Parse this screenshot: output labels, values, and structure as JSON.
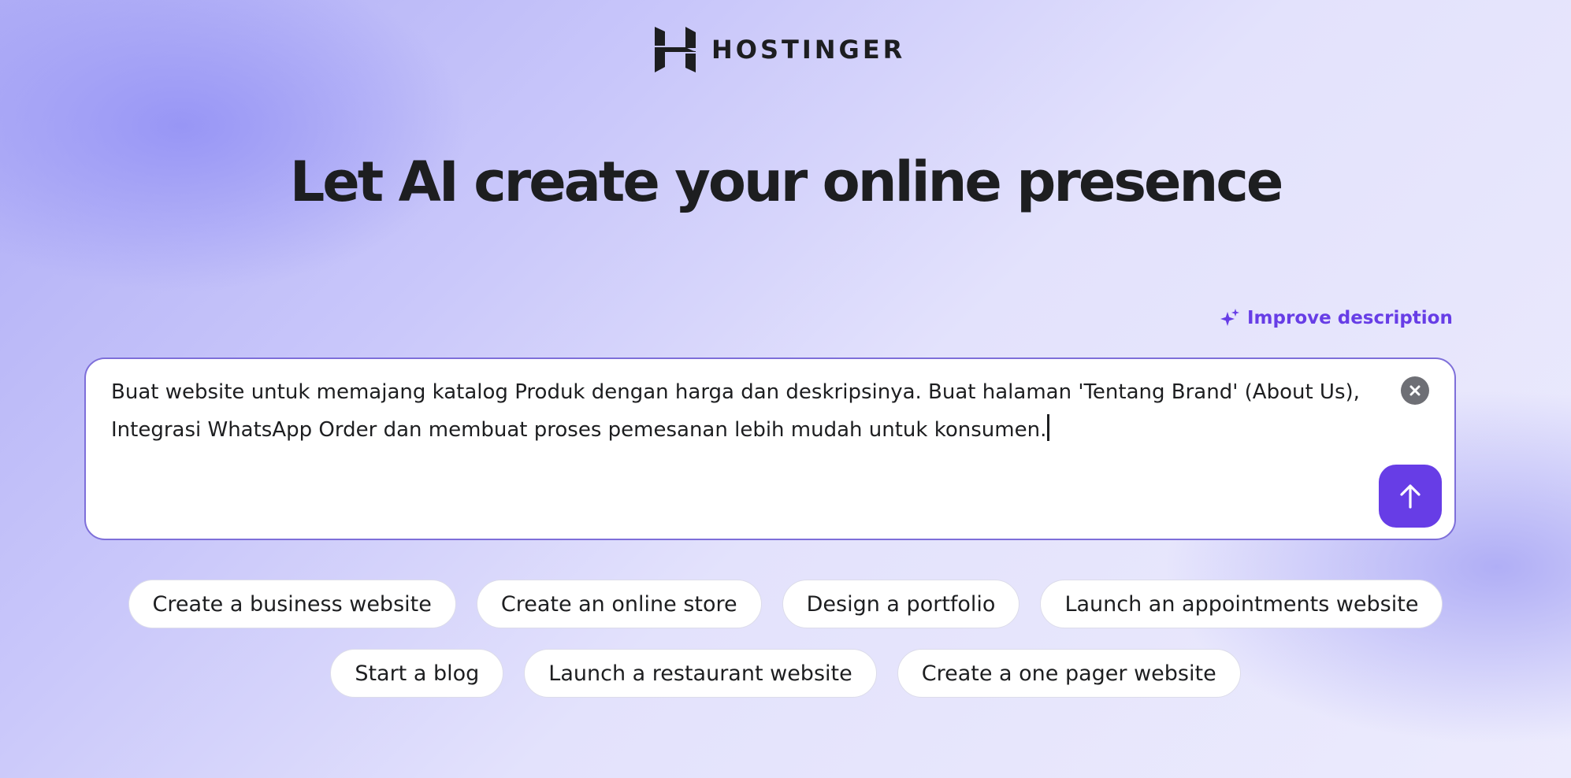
{
  "brand": {
    "name": "HOSTINGER",
    "accent_color": "#673de6",
    "logo_icon": "hostinger-h-logo-icon"
  },
  "hero": {
    "headline": "Let AI create your online presence"
  },
  "improve": {
    "label": "Improve description",
    "icon": "sparkles-icon"
  },
  "prompt": {
    "line1": "Buat website untuk memajang katalog Produk dengan harga dan deskripsinya. Buat halaman 'Tentang Brand' (About Us),",
    "line2": "Integrasi WhatsApp Order dan membuat proses pemesanan lebih mudah untuk konsumen.",
    "clear_icon": "close-circle-icon",
    "send_icon": "arrow-up-icon"
  },
  "suggestions": {
    "row1": [
      "Create a business website",
      "Create an online store",
      "Design a portfolio",
      "Launch an appointments website"
    ],
    "row2": [
      "Start a blog",
      "Launch a restaurant website",
      "Create a one pager website"
    ]
  }
}
